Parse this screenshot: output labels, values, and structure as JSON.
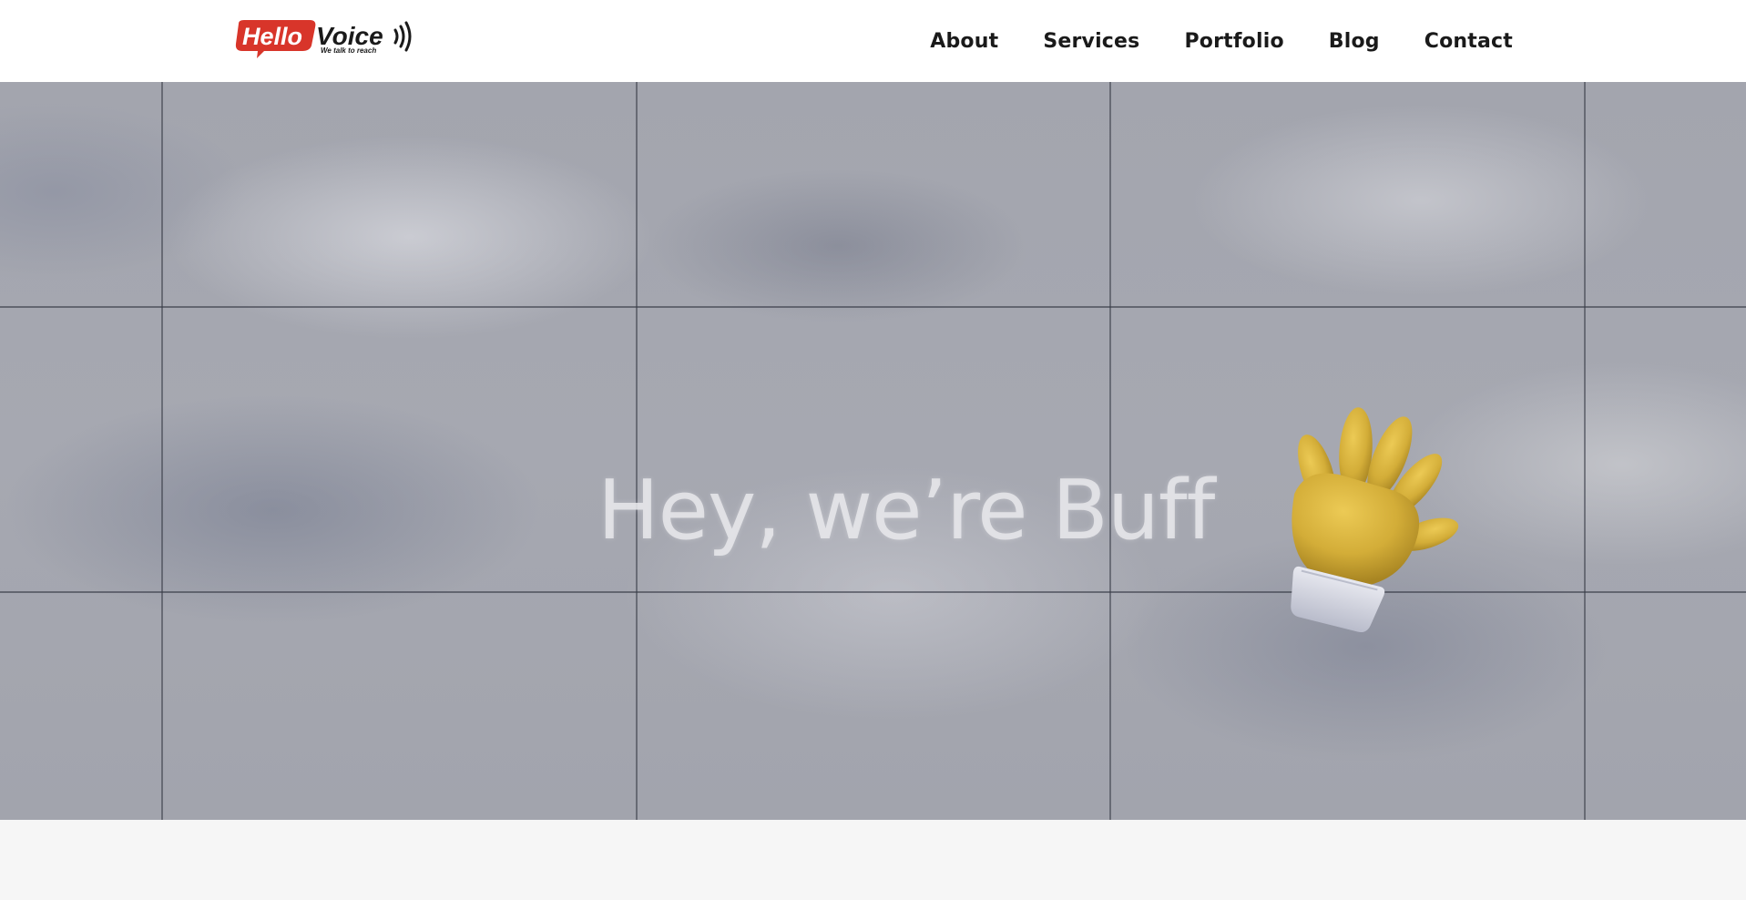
{
  "header": {
    "logo": {
      "brand_part1": "Hello",
      "brand_part2": "Voice",
      "tagline": "We talk to reach"
    },
    "nav": [
      {
        "label": "About"
      },
      {
        "label": "Services"
      },
      {
        "label": "Portfolio"
      },
      {
        "label": "Blog"
      },
      {
        "label": "Contact"
      }
    ]
  },
  "hero": {
    "title": "Hey, we’re Buff",
    "illustration": "waving-hand-icon"
  },
  "colors": {
    "logo_red": "#d8352a",
    "nav_text": "#1a1a1a",
    "hand_yellow": "#d8b23c",
    "footer_band": "#f6f6f6"
  }
}
